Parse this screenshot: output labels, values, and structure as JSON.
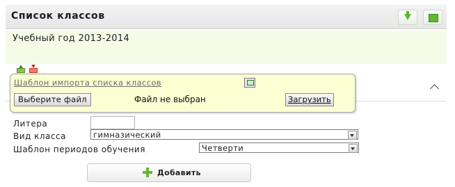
{
  "header": {
    "title": "Список классов",
    "down_icon": "green-arrow-down-icon",
    "square_icon": "green-square-icon"
  },
  "school_year": "Учебный год 2013-2014",
  "toolbar": {
    "import_icon": "import-icon",
    "export_icon": "export-icon"
  },
  "import_popup": {
    "template_link": "Шаблон импорта списка классов",
    "excel_icon": "excel-icon",
    "choose_file_button": "Выберите файл",
    "file_status": "Файл не выбран",
    "upload_button": "Загрузить"
  },
  "section": {
    "collapse_icon": "chevron-up-icon"
  },
  "form": {
    "litera_label": "Литера",
    "litera_value": "",
    "class_type_label": "Вид класса",
    "class_type_value": "гимназический",
    "period_template_label": "Шаблон периодов обучения",
    "period_template_value": "Четверти"
  },
  "add_button": {
    "label": "Добавить",
    "icon": "plus-icon"
  },
  "colors": {
    "accent_green": "#5db733",
    "year_row_bg": "#f6fbe8",
    "popup_bg": "#fbffd2"
  }
}
